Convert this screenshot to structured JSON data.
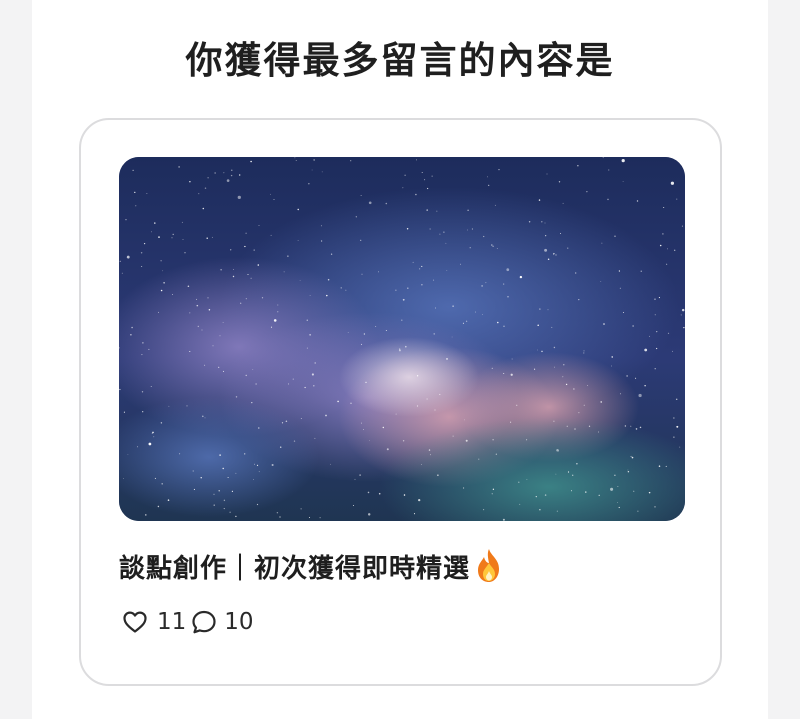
{
  "section": {
    "heading": "你獲得最多留言的內容是"
  },
  "post": {
    "cover_alt": "milky-way night sky photo",
    "title": "談點創作｜初次獲得即時精選",
    "title_emoji_icon": "fire-icon",
    "likes": "11",
    "comments": "10",
    "like_icon": "heart-outline-icon",
    "comment_icon": "speech-bubble-outline-icon"
  },
  "colors": {
    "page_background": "#f3f3f4",
    "panel_background": "#ffffff",
    "card_border": "#dcdcde",
    "text": "#1e1e1e",
    "sky_dark": "#1c2a56",
    "sky_purple": "#7a6aa8",
    "sky_pink": "#d59aa8",
    "sky_teal": "#2f6f78"
  }
}
